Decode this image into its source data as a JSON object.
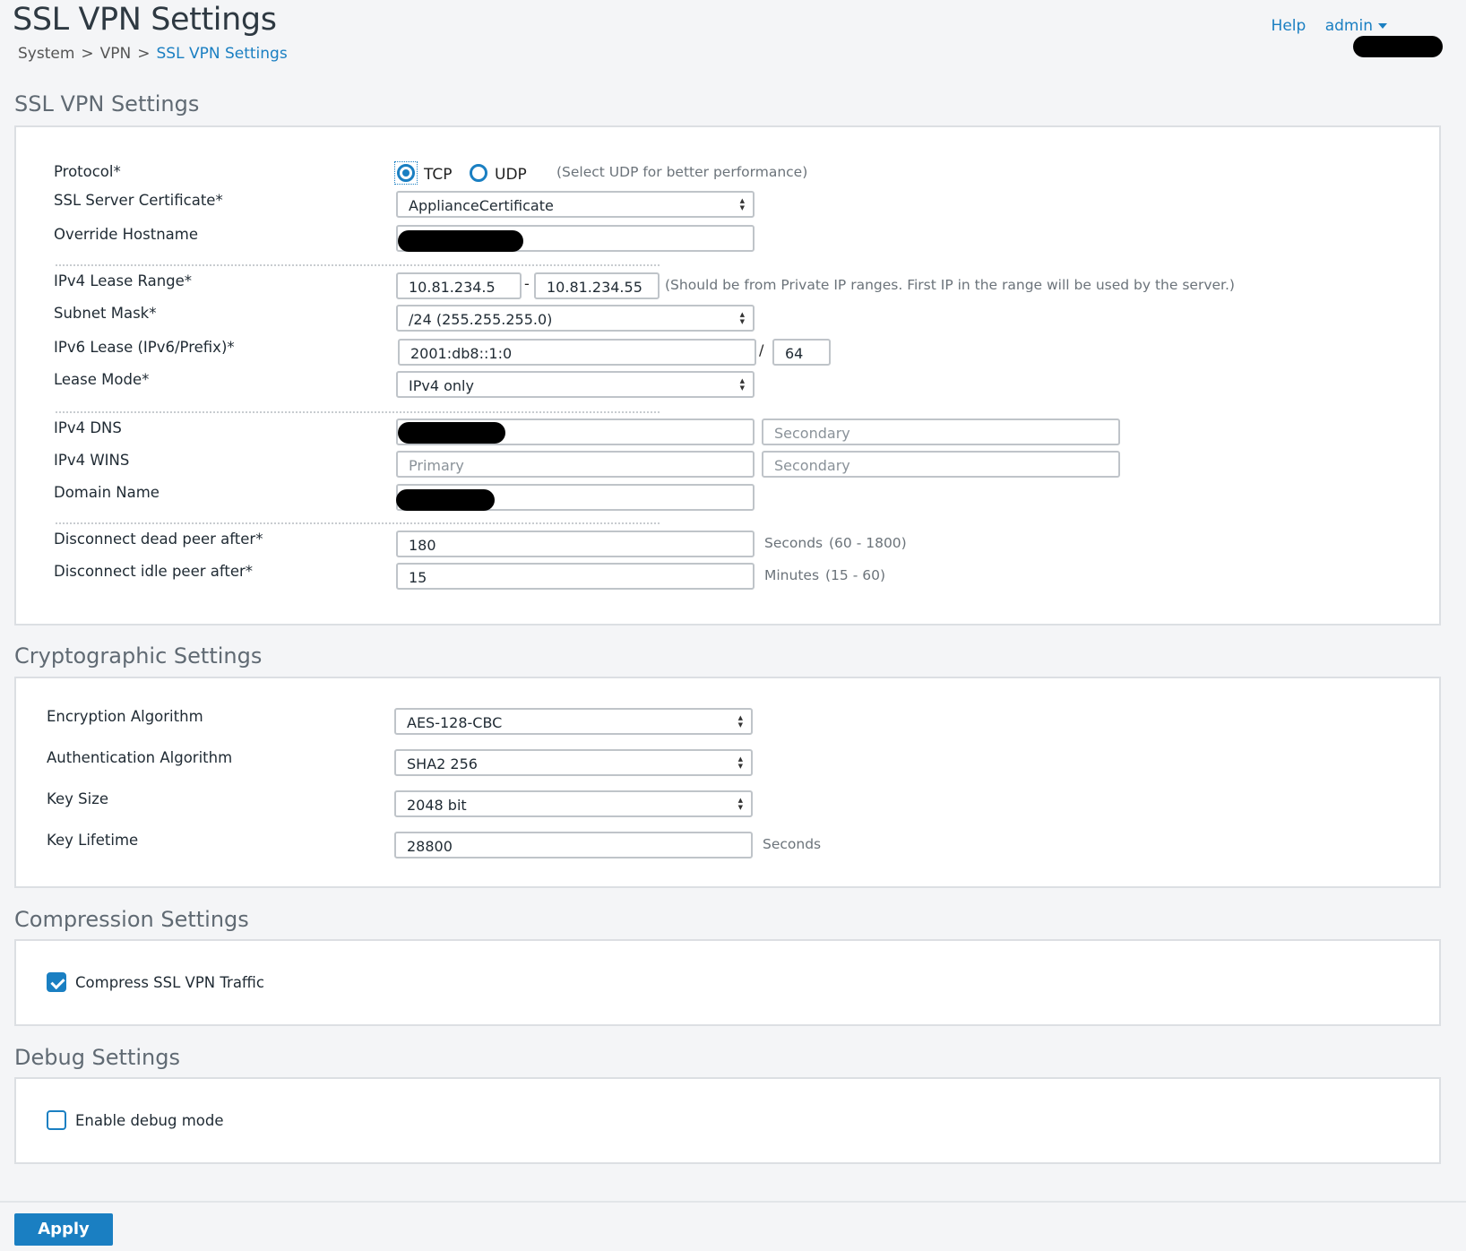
{
  "header": {
    "title": "SSL VPN Settings",
    "breadcrumb": [
      "System",
      "VPN",
      "SSL VPN Settings"
    ],
    "help": "Help",
    "user": "admin"
  },
  "ssl": {
    "title": "SSL VPN Settings",
    "protocol": {
      "label": "Protocol",
      "tcp": "TCP",
      "udp": "UDP",
      "selected": "TCP",
      "hint": "(Select UDP for better performance)"
    },
    "cert": {
      "label": "SSL Server Certificate",
      "value": "ApplianceCertificate"
    },
    "hostname": {
      "label": "Override Hostname"
    },
    "lease_range": {
      "label": "IPv4 Lease Range",
      "from": "10.81.234.5",
      "dash": "-",
      "to": "10.81.234.55",
      "hint": "(Should be from Private IP ranges. First IP in the range will be used by the server.)"
    },
    "subnet": {
      "label": "Subnet Mask",
      "value": "/24 (255.255.255.0)"
    },
    "ipv6": {
      "label": "IPv6 Lease (IPv6/Prefix)",
      "value": "2001:db8::1:0",
      "slash": "/",
      "prefix": "64"
    },
    "lease_mode": {
      "label": "Lease Mode",
      "value": "IPv4 only"
    },
    "dns": {
      "label": "IPv4 DNS",
      "secondary_placeholder": "Secondary"
    },
    "wins": {
      "label": "IPv4 WINS",
      "primary_placeholder": "Primary",
      "secondary_placeholder": "Secondary"
    },
    "domain": {
      "label": "Domain Name"
    },
    "dead_peer": {
      "label": "Disconnect dead peer after",
      "value": "180",
      "unit": "Seconds",
      "range": "(60 - 1800)"
    },
    "idle_peer": {
      "label": "Disconnect idle peer after",
      "value": "15",
      "unit": "Minutes",
      "range": "(15 - 60)"
    },
    "required_mark": "*"
  },
  "crypto": {
    "title": "Cryptographic Settings",
    "encryption": {
      "label": "Encryption Algorithm",
      "value": "AES-128-CBC"
    },
    "authentication": {
      "label": "Authentication Algorithm",
      "value": "SHA2 256"
    },
    "key_size": {
      "label": "Key Size",
      "value": "2048 bit"
    },
    "key_lifetime": {
      "label": "Key Lifetime",
      "value": "28800",
      "unit": "Seconds"
    }
  },
  "compression": {
    "title": "Compression Settings",
    "compress": {
      "label": "Compress SSL VPN Traffic",
      "checked": true
    }
  },
  "debug": {
    "title": "Debug Settings",
    "enable": {
      "label": "Enable debug mode",
      "checked": false
    }
  },
  "footer": {
    "apply": "Apply"
  },
  "colors": {
    "accent": "#1a7fc2",
    "redaction": "#000000"
  },
  "icons": {
    "caret": "chevron-down-icon",
    "check": "check-icon",
    "select_arrows": "select-arrows-icon"
  }
}
